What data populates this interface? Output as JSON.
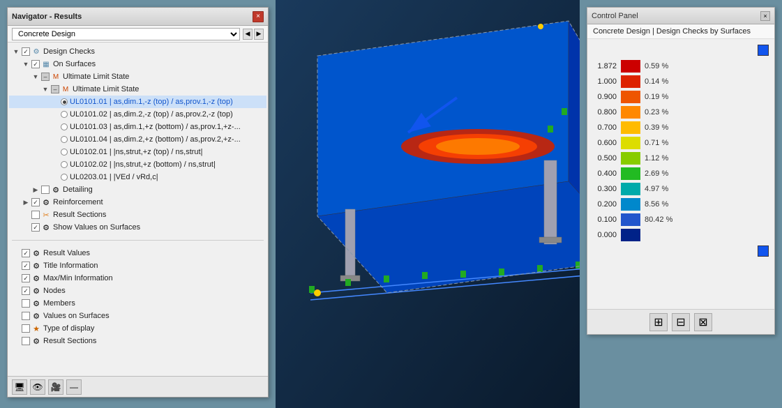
{
  "navigator": {
    "title": "Navigator - Results",
    "close_label": "×",
    "dropdown_value": "Concrete Design",
    "tree": {
      "design_checks": "Design Checks",
      "on_surfaces": "On Surfaces",
      "ultimate_limit_state_1": "Ultimate Limit State",
      "ultimate_limit_state_2": "Ultimate Limit State",
      "ul0101_01": "UL0101.01 | as,dim.1,-z (top) / as,prov.1,-z (top)",
      "ul0101_02": "UL0101.02 | as,dim.2,-z (top) / as,prov.2,-z (top)",
      "ul0101_03": "UL0101.03 | as,dim.1,+z (bottom) / as,prov.1,+z-...",
      "ul0101_04": "UL0101.04 | as,dim.2,+z (bottom) / as,prov.2,+z-...",
      "ul0102_01": "UL0102.01 | |ns,strut,+z (top) / ns,strut|",
      "ul0102_02": "UL0102.02 | |ns,strut,+z (bottom) / ns,strut|",
      "ul0203_01": "UL0203.01 | |VEd / vRd,c|",
      "detailing": "Detailing",
      "reinforcement": "Reinforcement",
      "result_sections_1": "Result Sections",
      "show_values": "Show Values on Surfaces",
      "result_values": "Result Values",
      "title_information": "Title Information",
      "max_min_information": "Max/Min Information",
      "nodes": "Nodes",
      "members": "Members",
      "values_on_surfaces": "Values on Surfaces",
      "type_of_display": "Type of display",
      "result_sections_2": "Result Sections"
    }
  },
  "control_panel": {
    "title": "Control Panel",
    "close_label": "×",
    "subtitle": "Concrete Design | Design Checks by Surfaces",
    "legend": [
      {
        "value": "1.872",
        "color": "#cc0000",
        "percent": "0.59 %",
        "top": true
      },
      {
        "value": "1.000",
        "color": "#dd2200",
        "percent": "0.14 %"
      },
      {
        "value": "0.900",
        "color": "#ee5500",
        "percent": "0.19 %"
      },
      {
        "value": "0.800",
        "color": "#ff8800",
        "percent": "0.23 %"
      },
      {
        "value": "0.700",
        "color": "#ffbb00",
        "percent": "0.39 %"
      },
      {
        "value": "0.600",
        "color": "#dddd00",
        "percent": "0.71 %"
      },
      {
        "value": "0.500",
        "color": "#88cc00",
        "percent": "1.12 %"
      },
      {
        "value": "0.400",
        "color": "#22bb22",
        "percent": "2.69 %"
      },
      {
        "value": "0.300",
        "color": "#00aaaa",
        "percent": "4.97 %"
      },
      {
        "value": "0.200",
        "color": "#0088cc",
        "percent": "8.56 %"
      },
      {
        "value": "0.100",
        "color": "#2255cc",
        "percent": "80.42 %"
      },
      {
        "value": "0.000",
        "color": "#002288",
        "percent": ""
      }
    ],
    "top_indicator": "▐",
    "bottom_indicator": "▐",
    "bottom_buttons": [
      "⊞",
      "⊟",
      "⊠"
    ]
  },
  "bottom_toolbar": {
    "btn1": "🖥",
    "btn2": "👁",
    "btn3": "🎥",
    "btn4": "—"
  }
}
